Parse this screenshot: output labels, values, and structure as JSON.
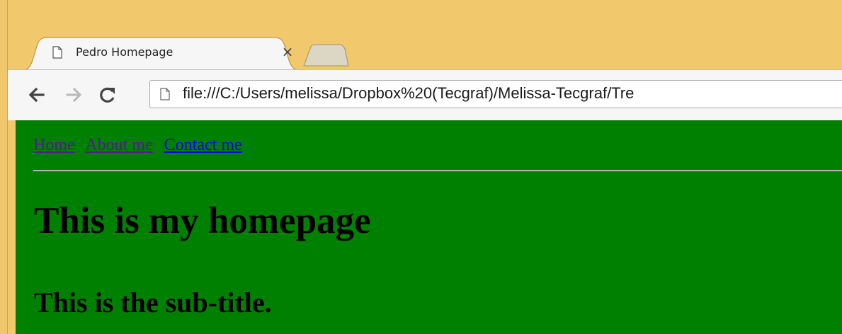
{
  "browser": {
    "tab": {
      "title": "Pedro Homepage",
      "close_glyph": "×",
      "icon": "page-icon"
    },
    "new_tab_icon": "new-tab-icon",
    "toolbar": {
      "back_icon": "arrow-left-icon",
      "forward_icon": "arrow-right-icon",
      "reload_icon": "reload-icon"
    },
    "address_bar": {
      "icon": "page-icon",
      "url": "file:///C:/Users/melissa/Dropbox%20(Tecgraf)/Melissa-Tecgraf/Tre"
    },
    "colors": {
      "frame": "#f2c86c",
      "toolbar": "#f6f6f6",
      "page_background": "#008000",
      "visited_link": "#551a8b",
      "unvisited_link": "#0000ee"
    }
  },
  "page": {
    "nav": {
      "links": [
        "Home",
        "About me",
        "Contact me"
      ]
    },
    "title": "This is my homepage",
    "subtitle": "This is the sub-title."
  }
}
